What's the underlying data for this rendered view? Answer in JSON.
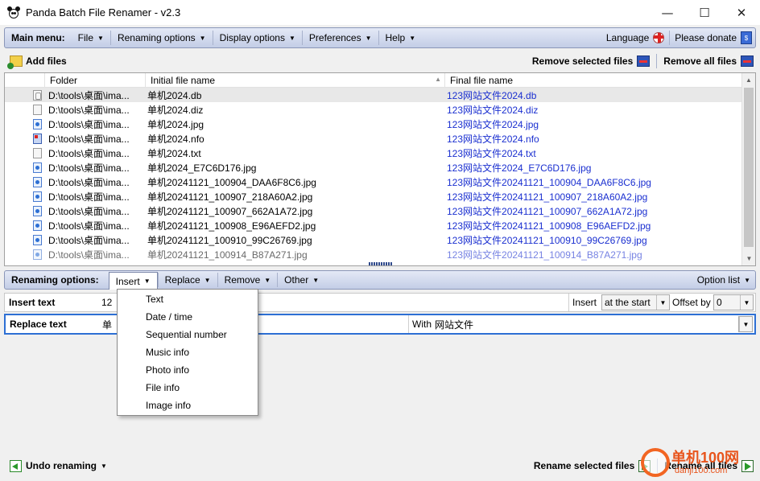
{
  "window": {
    "title": "Panda Batch File Renamer - v2.3",
    "controls": {
      "minimize": "—",
      "maximize": "☐",
      "close": "✕"
    }
  },
  "main_menu": {
    "lead": "Main menu:",
    "items": [
      "File",
      "Renaming options",
      "Display options",
      "Preferences",
      "Help"
    ],
    "language": "Language",
    "donate": "Please donate"
  },
  "toolbar": {
    "add_files": "Add files",
    "remove_selected": "Remove selected files",
    "remove_all": "Remove all files"
  },
  "file_list": {
    "columns": {
      "folder": "Folder",
      "initial": "Initial file name",
      "final": "Final file name"
    },
    "rows": [
      {
        "type": "db",
        "folder": "D:\\tools\\桌面\\ima...",
        "initial": "单机2024.db",
        "final": "123网站文件2024.db",
        "selected": true
      },
      {
        "type": "txt",
        "folder": "D:\\tools\\桌面\\ima...",
        "initial": "单机2024.diz",
        "final": "123网站文件2024.diz"
      },
      {
        "type": "jpg",
        "folder": "D:\\tools\\桌面\\ima...",
        "initial": "单机2024.jpg",
        "final": "123网站文件2024.jpg"
      },
      {
        "type": "nfo",
        "folder": "D:\\tools\\桌面\\ima...",
        "initial": "单机2024.nfo",
        "final": "123网站文件2024.nfo"
      },
      {
        "type": "txt",
        "folder": "D:\\tools\\桌面\\ima...",
        "initial": "单机2024.txt",
        "final": "123网站文件2024.txt"
      },
      {
        "type": "jpg",
        "folder": "D:\\tools\\桌面\\ima...",
        "initial": "单机2024_E7C6D176.jpg",
        "final": "123网站文件2024_E7C6D176.jpg"
      },
      {
        "type": "jpg",
        "folder": "D:\\tools\\桌面\\ima...",
        "initial": "单机20241121_100904_DAA6F8C6.jpg",
        "final": "123网站文件20241121_100904_DAA6F8C6.jpg"
      },
      {
        "type": "jpg",
        "folder": "D:\\tools\\桌面\\ima...",
        "initial": "单机20241121_100907_218A60A2.jpg",
        "final": "123网站文件20241121_100907_218A60A2.jpg"
      },
      {
        "type": "jpg",
        "folder": "D:\\tools\\桌面\\ima...",
        "initial": "单机20241121_100907_662A1A72.jpg",
        "final": "123网站文件20241121_100907_662A1A72.jpg"
      },
      {
        "type": "jpg",
        "folder": "D:\\tools\\桌面\\ima...",
        "initial": "单机20241121_100908_E96AEFD2.jpg",
        "final": "123网站文件20241121_100908_E96AEFD2.jpg"
      },
      {
        "type": "jpg",
        "folder": "D:\\tools\\桌面\\ima...",
        "initial": "单机20241121_100910_99C26769.jpg",
        "final": "123网站文件20241121_100910_99C26769.jpg"
      },
      {
        "type": "jpg",
        "folder": "D:\\tools\\桌面\\ima...",
        "initial": "单机20241121_100914_B87A271.jpg",
        "final": "123网站文件20241121_100914_B87A271.jpg"
      }
    ]
  },
  "renaming_options": {
    "lead": "Renaming options:",
    "tabs": [
      "Insert",
      "Replace",
      "Remove",
      "Other"
    ],
    "option_list": "Option list"
  },
  "rules": {
    "insert": {
      "label": "Insert text",
      "value": "12",
      "mode_label": "Insert",
      "mode_value": "at the start",
      "offset_label": "Offset by",
      "offset_value": "0"
    },
    "replace": {
      "label": "Replace text",
      "value": "单",
      "with_label": "With",
      "with_value": "网站文件"
    }
  },
  "insert_menu": {
    "items": [
      "Text",
      "Date / time",
      "Sequential number",
      "Music info",
      "Photo info",
      "File info",
      "Image info"
    ]
  },
  "bottom": {
    "undo": "Undo renaming",
    "rename_selected": "Rename selected files",
    "rename_all": "Rename all files"
  },
  "watermark": {
    "line1": "单机100网",
    "line2": "danji100.com"
  },
  "colors": {
    "final_name": "#1a2fd0",
    "accent": "#2d6fd4",
    "bar_top": "#e4e9f6",
    "bar_bottom": "#c3cde6"
  }
}
